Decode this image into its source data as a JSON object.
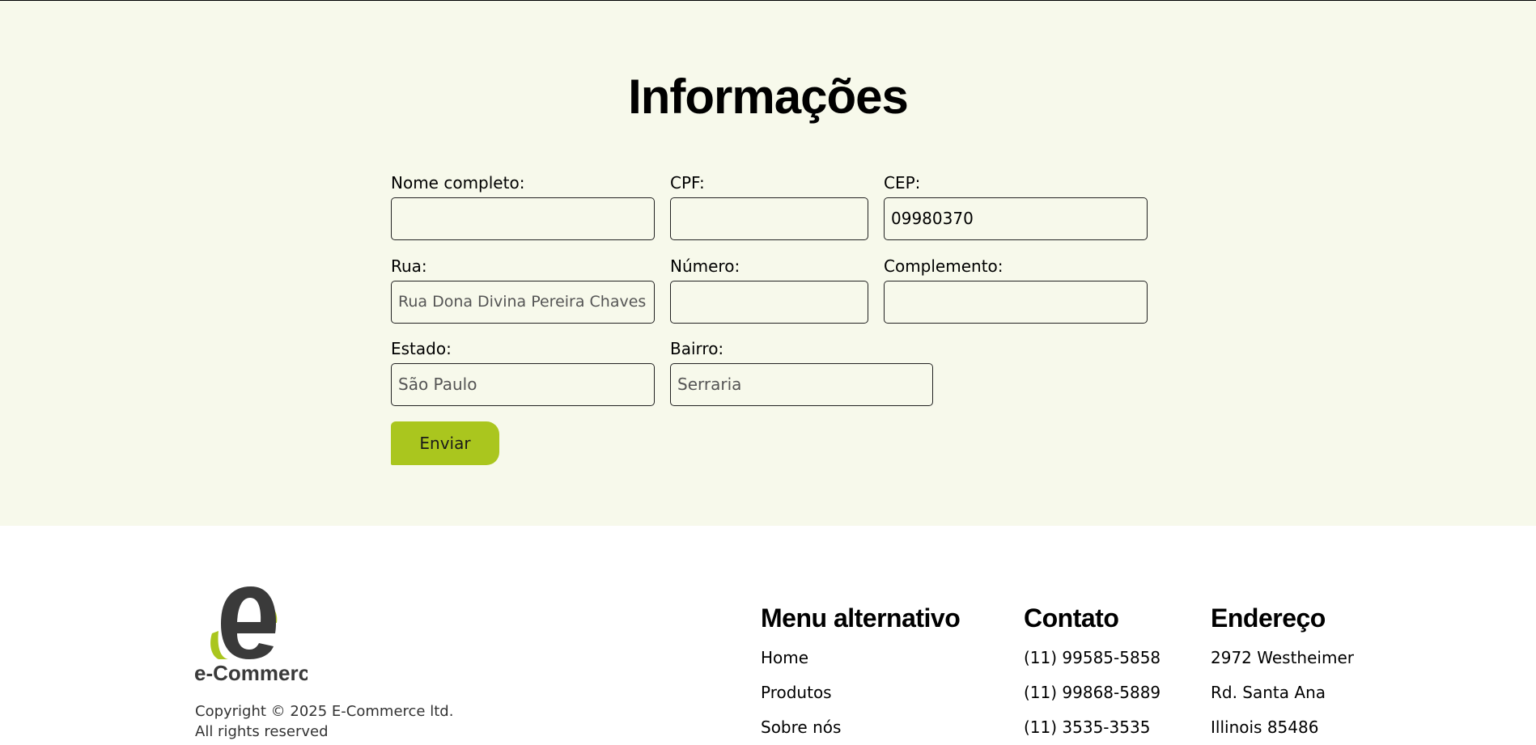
{
  "form": {
    "title": "Informações",
    "fields": {
      "nome": {
        "label": "Nome completo:",
        "value": ""
      },
      "cpf": {
        "label": "CPF:",
        "value": ""
      },
      "cep": {
        "label": "CEP:",
        "value": "09980370"
      },
      "rua": {
        "label": "Rua:",
        "value": "Rua Dona Divina Pereira Chaves"
      },
      "numero": {
        "label": "Número:",
        "value": ""
      },
      "complemento": {
        "label": "Complemento:",
        "value": ""
      },
      "estado": {
        "label": "Estado:",
        "value": "São Paulo"
      },
      "bairro": {
        "label": "Bairro:",
        "value": "Serraria"
      }
    },
    "submit_label": "Enviar",
    "accent_color": "#aac61e",
    "background_color": "#f7f9eb"
  },
  "footer": {
    "logo_text": "e-Commerce",
    "copyright_line1": "Copyright © 2025 E-Commerce ltd.",
    "copyright_line2": "All rights reserved",
    "menu": {
      "heading": "Menu alternativo",
      "items": [
        "Home",
        "Produtos",
        "Sobre nós"
      ]
    },
    "contato": {
      "heading": "Contato",
      "items": [
        "(11) 99585-5858",
        "(11) 99868-5889",
        "(11) 3535-3535"
      ]
    },
    "endereco": {
      "heading": "Endereço",
      "items": [
        "2972 Westheimer",
        "Rd. Santa Ana",
        "Illinois 85486"
      ]
    }
  }
}
